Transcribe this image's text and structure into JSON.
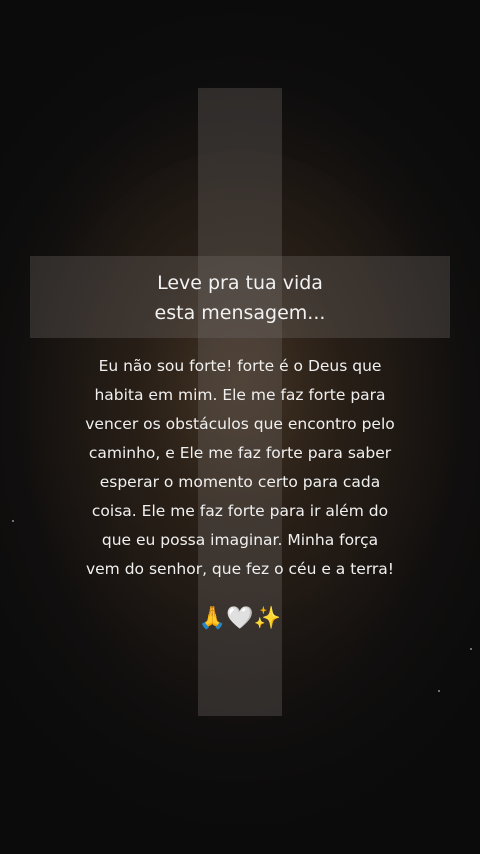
{
  "headline": {
    "lines": [
      "Leve pra tua vida",
      "esta mensagem..."
    ]
  },
  "message": {
    "lines": [
      "Eu não sou forte! forte é o Deus que",
      "habita em mim. Ele me faz forte para",
      "vencer os obstáculos que encontro pelo",
      "caminho, e Ele me faz forte para saber",
      "esperar o momento certo para cada",
      "coisa. Ele me faz forte para ir além do",
      "que eu possa imaginar. Minha força",
      "vem do senhor, que fez o céu e a terra!"
    ]
  },
  "emojis": "🙏🤍✨",
  "colors": {
    "background": "#0b0b0c",
    "cross": "#736e69",
    "text": "#f0f0f0"
  }
}
